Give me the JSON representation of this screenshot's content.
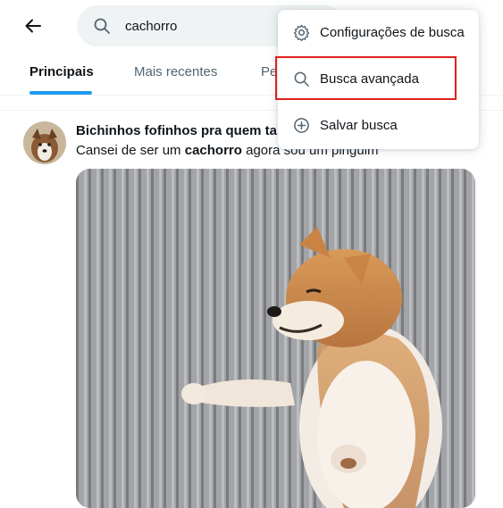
{
  "search": {
    "value": "cachorro"
  },
  "tabs": [
    {
      "label": "Principais",
      "active": true
    },
    {
      "label": "Mais recentes",
      "active": false
    },
    {
      "label": "Pe",
      "active": false
    }
  ],
  "tweet": {
    "name": "Bichinhos fofinhos pra quem ta",
    "text_before": "Cansei de ser um ",
    "text_bold": "cachorro",
    "text_after": " agora sou um pinguim"
  },
  "menu": {
    "items": [
      {
        "label": "Configurações de busca",
        "icon": "gear-icon"
      },
      {
        "label": "Busca avançada",
        "icon": "search-icon",
        "highlighted": true
      },
      {
        "label": "Salvar busca",
        "icon": "plus-circle-icon"
      }
    ]
  },
  "colors": {
    "accent": "#1d9bf0",
    "highlight": "#e0201f",
    "search_bg": "#eff3f4"
  }
}
